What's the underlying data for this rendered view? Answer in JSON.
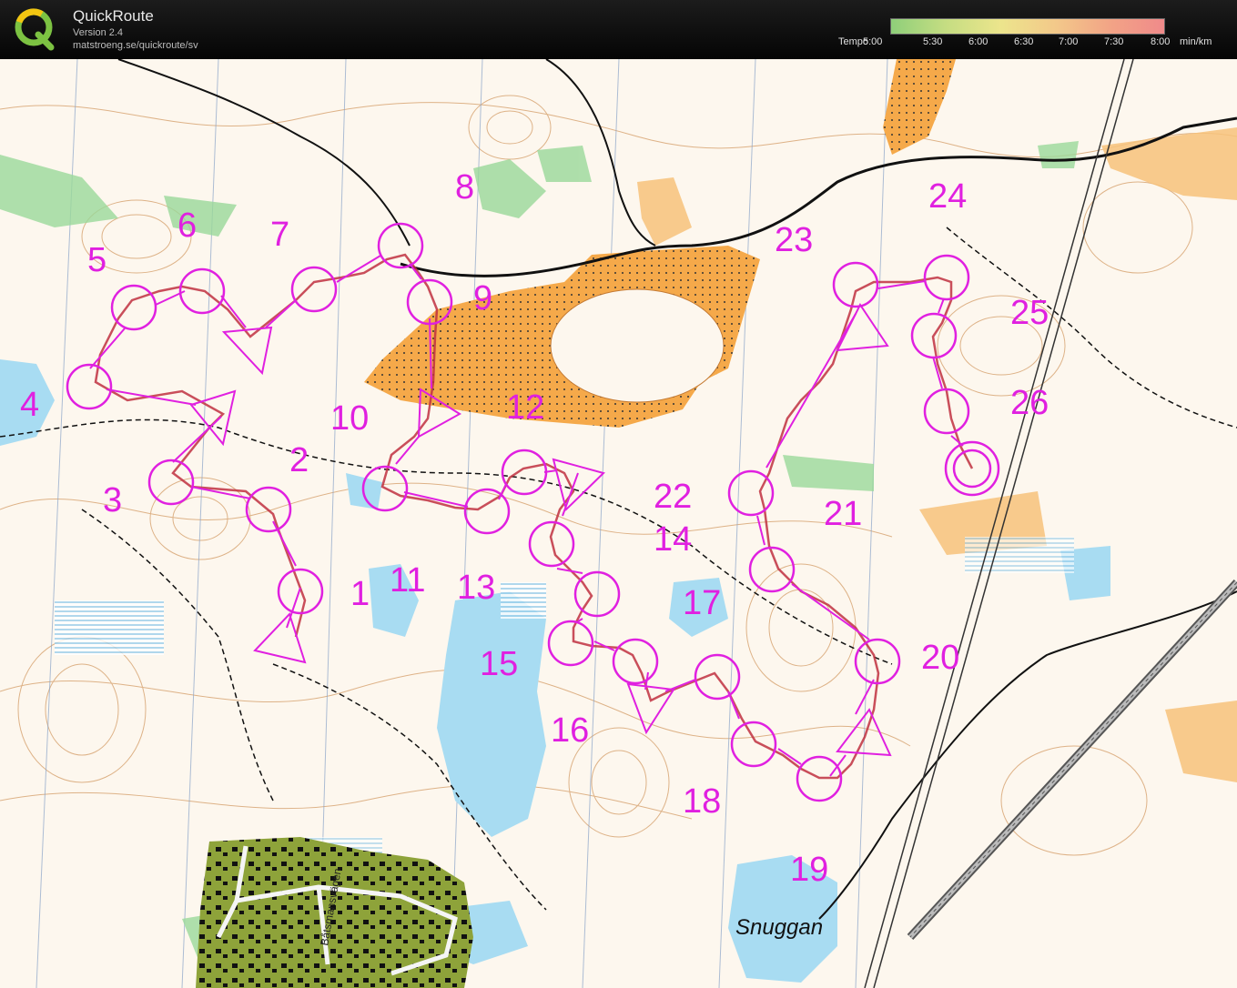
{
  "app": {
    "title": "QuickRoute",
    "version": "Version 2.4",
    "url": "matstroeng.se/quickroute/sv"
  },
  "tempo_scale": {
    "label": "Tempo",
    "ticks": [
      "5:00",
      "5:30",
      "6:00",
      "6:30",
      "7:00",
      "7:30",
      "8:00"
    ],
    "unit": "min/km",
    "colors": [
      "#8fcf7a",
      "#c5dd82",
      "#ece58c",
      "#f3c98a",
      "#f2a486",
      "#f08a8a"
    ]
  },
  "colors": {
    "course": "#e020e0",
    "route": "#c03040",
    "contour": "#b5651d",
    "open_land": "#f5a94a",
    "water": "#9fd8ef",
    "green": "#8fd08a",
    "settlement": "#7f9a2a"
  },
  "map": {
    "control_labels": [
      "1",
      "2",
      "3",
      "4",
      "5",
      "6",
      "7",
      "8",
      "9",
      "10",
      "11",
      "12",
      "13",
      "14",
      "15",
      "16",
      "17",
      "18",
      "19",
      "20",
      "21",
      "22",
      "23",
      "24",
      "25",
      "26"
    ],
    "place_names": [
      "Snuggan"
    ],
    "street_names": [
      "Båtsmansvägen"
    ]
  }
}
